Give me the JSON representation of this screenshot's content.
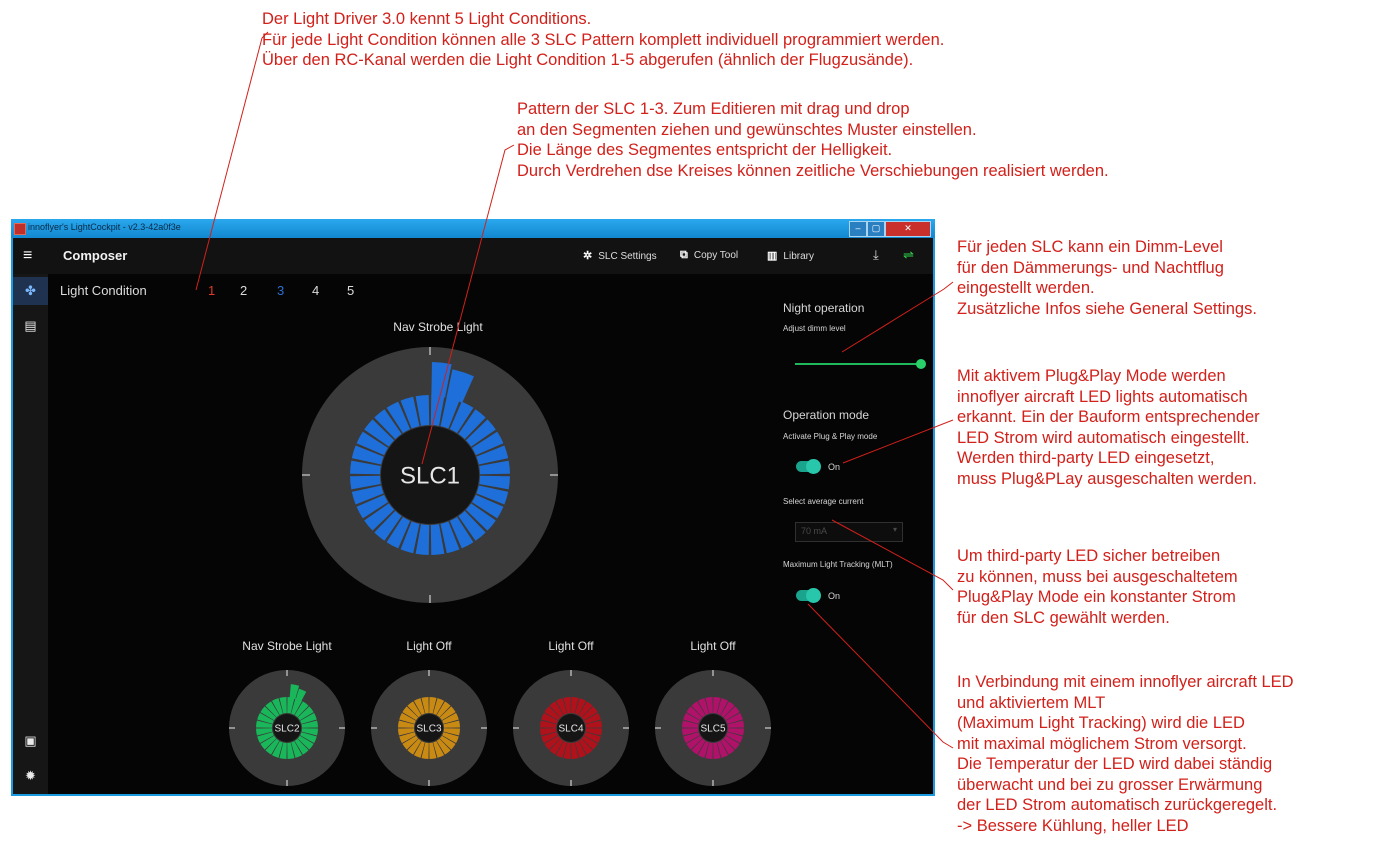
{
  "annotations": {
    "top": [
      "Der Light Driver 3.0 kennt 5 Light Conditions.",
      "Für jede Light Condition können alle 3 SLC Pattern komplett individuell programmiert werden.",
      "Über den RC-Kanal werden die Light Condition 1-5 abgerufen (ähnlich der Flugzusände)."
    ],
    "pattern": [
      "Pattern der SLC 1-3. Zum Editieren mit drag und drop",
      "an den Segmenten ziehen und gewünschtes Muster einstellen.",
      "Die Länge des Segmentes entspricht der Helligkeit.",
      "Durch Verdrehen dse Kreises können zeitliche Verschiebungen realisiert werden."
    ],
    "dimm": [
      "Für jeden SLC kann ein Dimm-Level",
      "für den Dämmerungs- und Nachtflug",
      "eingestellt werden.",
      "Zusätzliche Infos siehe General Settings."
    ],
    "plugplay": [
      "Mit aktivem Plug&Play Mode werden",
      "innoflyer aircraft LED lights automatisch",
      "erkannt. Ein der Bauform entsprechender",
      "LED Strom wird automatisch eingestellt.",
      "Werden third-party LED eingesetzt,",
      "muss Plug&PLay ausgeschalten werden."
    ],
    "thirdparty": [
      "Um third-party LED sicher betreiben",
      "zu können, muss bei ausgeschaltetem",
      "Plug&Play Mode ein konstanter Strom",
      "für den SLC gewählt werden."
    ],
    "mlt": [
      "In Verbindung mit einem innoflyer aircraft LED",
      "und aktiviertem MLT",
      "(Maximum Light Tracking) wird die LED",
      "mit maximal möglichem Strom versorgt.",
      "Die Temperatur der LED wird dabei ständig",
      "überwacht und bei zu grosser Erwärmung",
      "der LED Strom automatisch zurückgeregelt.",
      "-> Bessere Kühlung, heller LED"
    ]
  },
  "window": {
    "title": "innoflyer's LightCockpit - v2.3-42a0f3e",
    "controls": [
      "–",
      "▢",
      "✕"
    ]
  },
  "appbar": {
    "menu_icon": "≡",
    "title": "Composer",
    "slc_settings": "SLC Settings",
    "copy_tool": "Copy Tool",
    "library": "Library"
  },
  "icons": {
    "slc_settings": "gears-icon",
    "copy_tool": "copy-icon",
    "library": "library-icon",
    "download": "download-icon",
    "usb": "usb-icon",
    "sidebar": [
      "fan-icon",
      "document-icon",
      "save-icon",
      "gear-icon"
    ]
  },
  "light_condition": {
    "label": "Light Condition",
    "numbers": [
      "1",
      "2",
      "3",
      "4",
      "5"
    ],
    "selected": "1",
    "colors": [
      "#e03a2a",
      "#dcdcdc",
      "#2e6fd0",
      "#dcdcdc",
      "#dcdcdc"
    ]
  },
  "main_circle": {
    "title": "Nav Strobe Light",
    "label": "SLC1",
    "color": "#1e6fd9"
  },
  "small_circles": [
    {
      "title": "Nav Strobe Light",
      "label": "SLC2",
      "color": "#19b75a"
    },
    {
      "title": "Light Off",
      "label": "SLC3",
      "color": "#c98a14"
    },
    {
      "title": "Light Off",
      "label": "SLC4",
      "color": "#b0121c"
    },
    {
      "title": "Light Off",
      "label": "SLC5",
      "color": "#b0126a"
    }
  ],
  "right_panel": {
    "night_operation": "Night operation",
    "adjust_dimm": "Adjust dimm level",
    "dimm_level": 1.0,
    "operation_mode": "Operation mode",
    "activate_pnp": "Activate Plug & Play mode",
    "pnp_state": "On",
    "select_current": "Select average current",
    "current_value": "70 mA",
    "mlt_label": "Maximum Light Tracking (MLT)",
    "mlt_state": "On"
  },
  "colors": {
    "annotation": "#d2201a",
    "accent_teal": "#1aa48e",
    "slider_green": "#1fb85a",
    "app_bg": "#050505"
  }
}
